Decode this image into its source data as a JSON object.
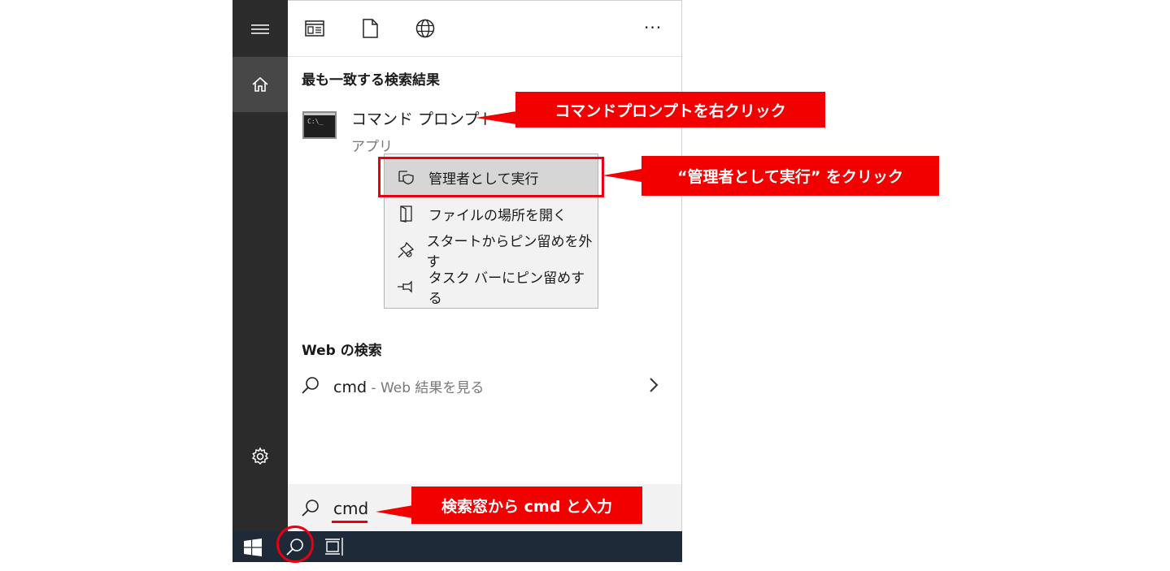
{
  "colors": {
    "rail": "#2b2b2b",
    "rail_active": "#474747",
    "taskbar": "#1f2a38",
    "accent_red": "#e60012",
    "menu_bg": "#f2f2f2"
  },
  "toolbar": {
    "icons": [
      "apps-icon",
      "document-icon",
      "globe-icon"
    ],
    "more_label": "···"
  },
  "best_match": {
    "heading": "最も一致する検索結果",
    "app_name": "コマンド プロンプト",
    "app_type": "アプリ"
  },
  "context_menu": {
    "items": [
      {
        "label": "管理者として実行",
        "icon": "shield-icon"
      },
      {
        "label": "ファイルの場所を開く",
        "icon": "folder-icon"
      },
      {
        "label": "スタートからピン留めを外す",
        "icon": "unpin-icon"
      },
      {
        "label": "タスク バーにピン留めする",
        "icon": "pin-icon"
      }
    ]
  },
  "web_search": {
    "heading": "Web の検索",
    "query": "cmd",
    "suffix": " - Web 結果を見る"
  },
  "search_box": {
    "value": "cmd"
  },
  "callouts": {
    "right_click": "コマンドプロンプトを右クリック",
    "run_admin": "“管理者として実行” をクリック",
    "type_cmd": "検索窓から cmd と入力"
  }
}
